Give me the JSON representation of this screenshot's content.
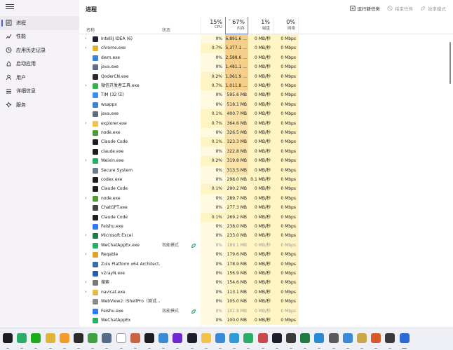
{
  "sidebar": {
    "items": [
      {
        "label": "进程",
        "icon": "processes-icon",
        "active": true
      },
      {
        "label": "性能",
        "icon": "performance-icon"
      },
      {
        "label": "应用历史记录",
        "icon": "app-history-icon"
      },
      {
        "label": "启动应用",
        "icon": "startup-apps-icon"
      },
      {
        "label": "用户",
        "icon": "users-icon"
      },
      {
        "label": "详细信息",
        "icon": "details-icon"
      },
      {
        "label": "服务",
        "icon": "services-icon"
      }
    ]
  },
  "main": {
    "title": "进程",
    "toolbar": {
      "run_new_task": "运行新任务",
      "end_task": "结束任务",
      "efficiency_mode": "效率模式"
    }
  },
  "columns": {
    "name": "名称",
    "status": "状态",
    "cpu": {
      "pct": "15%",
      "label": "CPU"
    },
    "memory": {
      "pct": "67%",
      "label": "内存"
    },
    "disk": {
      "pct": "1%",
      "label": "磁盘"
    },
    "network": {
      "pct": "0%",
      "label": "网络"
    }
  },
  "processes": [
    {
      "name": "IntelliJ IDEA (6)",
      "expand": true,
      "status": "",
      "cpu": "0%",
      "mem": "6,891.6 ...",
      "disk": "0 MB/秒",
      "net": "0 Mbps",
      "icon_color": "#1d1d2b"
    },
    {
      "name": "chrome.exe",
      "expand": true,
      "status": "",
      "cpu": "0.7%",
      "mem": "5,377.1 ...",
      "disk": "0 MB/秒",
      "net": "0 Mbps",
      "icon_color": "#e2b33a"
    },
    {
      "name": "dwm.exe",
      "expand": false,
      "status": "",
      "cpu": "0%",
      "mem": "2,588.6 ...",
      "disk": "0 MB/秒",
      "net": "0 Mbps",
      "icon_color": "#3c83d6"
    },
    {
      "name": "java.exe",
      "expand": false,
      "status": "",
      "cpu": "0%",
      "mem": "1,481.1 ...",
      "disk": "0 MB/秒",
      "net": "0 Mbps",
      "icon_color": "#5c6b7e"
    },
    {
      "name": "QoderCN.exe",
      "expand": false,
      "status": "",
      "cpu": "0.2%",
      "mem": "1,061.9 ...",
      "disk": "0 MB/秒",
      "net": "0 Mbps",
      "icon_color": "#2a2a2a"
    },
    {
      "name": "微信开发者工具.exe",
      "expand": true,
      "status": "",
      "cpu": "0.7%",
      "mem": "1,011.8 ...",
      "disk": "0 MB/秒",
      "net": "0 Mbps",
      "icon_color": "#36b04a"
    },
    {
      "name": "TIM (32 位)",
      "expand": false,
      "status": "",
      "cpu": "0%",
      "mem": "595.6 MB",
      "disk": "0 MB/秒",
      "net": "0 Mbps",
      "icon_color": "#3b8ef2"
    },
    {
      "name": "wsappx",
      "expand": false,
      "status": "",
      "cpu": "0%",
      "mem": "518.1 MB",
      "disk": "0 MB/秒",
      "net": "0 Mbps",
      "icon_color": "#3c83d6"
    },
    {
      "name": "java.exe",
      "expand": false,
      "status": "",
      "cpu": "0.1%",
      "mem": "400.7 MB",
      "disk": "0 MB/秒",
      "net": "0 Mbps",
      "icon_color": "#5c6b7e"
    },
    {
      "name": "explorer.exe",
      "expand": true,
      "status": "",
      "cpu": "0.7%",
      "mem": "364.6 MB",
      "disk": "0 MB/秒",
      "net": "0 Mbps",
      "icon_color": "#f2c24a"
    },
    {
      "name": "node.exe",
      "expand": false,
      "status": "",
      "cpu": "0%",
      "mem": "326.5 MB",
      "disk": "0 MB/秒",
      "net": "0 Mbps",
      "icon_color": "#4f9a3a"
    },
    {
      "name": "Claude Code",
      "expand": false,
      "status": "",
      "cpu": "0.1%",
      "mem": "323.3 MB",
      "disk": "0 MB/秒",
      "net": "0 Mbps",
      "icon_color": "#1e1e1e"
    },
    {
      "name": "claude.exe",
      "expand": false,
      "status": "",
      "cpu": "0%",
      "mem": "322.8 MB",
      "disk": "0 MB/秒",
      "net": "0 Mbps",
      "icon_color": "#1e1e1e"
    },
    {
      "name": "Weixin.exe",
      "expand": true,
      "status": "",
      "cpu": "0.2%",
      "mem": "319.8 MB",
      "disk": "0 MB/秒",
      "net": "0 Mbps",
      "icon_color": "#2aae67"
    },
    {
      "name": "Secure System",
      "expand": false,
      "status": "",
      "cpu": "0%",
      "mem": "313.5 MB",
      "disk": "0 MB/秒",
      "net": "0 Mbps",
      "icon_color": "#6c7a8a"
    },
    {
      "name": "codex.exe",
      "expand": false,
      "status": "",
      "cpu": "0%",
      "mem": "298.0 MB",
      "disk": "0.1 MB/秒",
      "net": "0 Mbps",
      "icon_color": "#1e1e1e"
    },
    {
      "name": "Claude Code",
      "expand": false,
      "status": "",
      "cpu": "0.1%",
      "mem": "290.2 MB",
      "disk": "0 MB/秒",
      "net": "0 Mbps",
      "icon_color": "#1e1e1e"
    },
    {
      "name": "node.exe",
      "expand": true,
      "status": "",
      "cpu": "0%",
      "mem": "289.7 MB",
      "disk": "0 MB/秒",
      "net": "0 Mbps",
      "icon_color": "#4f9a3a"
    },
    {
      "name": "ChatGPT.exe",
      "expand": false,
      "status": "",
      "cpu": "0%",
      "mem": "277.3 MB",
      "disk": "0 MB/秒",
      "net": "0 Mbps",
      "icon_color": "#444444"
    },
    {
      "name": "Claude Code",
      "expand": false,
      "status": "",
      "cpu": "0.1%",
      "mem": "269.2 MB",
      "disk": "0 MB/秒",
      "net": "0 Mbps",
      "icon_color": "#1e1e1e"
    },
    {
      "name": "Feishu.exe",
      "expand": false,
      "status": "",
      "cpu": "0%",
      "mem": "238.0 MB",
      "disk": "0 MB/秒",
      "net": "0 Mbps",
      "icon_color": "#2f7af2"
    },
    {
      "name": "Microsoft Excel",
      "expand": true,
      "status": "",
      "cpu": "0%",
      "mem": "233.0 MB",
      "disk": "0 MB/秒",
      "net": "0 Mbps",
      "icon_color": "#1f7a43"
    },
    {
      "name": "WeChatAppEx.exe",
      "expand": false,
      "status": "效能模式",
      "leaf": true,
      "cpu": "0%",
      "mem": "189.1 MB",
      "disk": "0 MB/秒",
      "net": "0 Mbps",
      "icon_color": "#2aae67"
    },
    {
      "name": "Reqable",
      "expand": true,
      "status": "",
      "cpu": "0%",
      "mem": "179.6 MB",
      "disk": "0 MB/秒",
      "net": "0 Mbps",
      "icon_color": "#e0a32a"
    },
    {
      "name": "Zulu Platform x64 Architect...",
      "expand": false,
      "status": "",
      "cpu": "0%",
      "mem": "178.9 MB",
      "disk": "0 MB/秒",
      "net": "0 Mbps",
      "icon_color": "#3b6ea8"
    },
    {
      "name": "v2rayN.exe",
      "expand": false,
      "status": "",
      "cpu": "0%",
      "mem": "156.9 MB",
      "disk": "0 MB/秒",
      "net": "0 Mbps",
      "icon_color": "#2a5fa8"
    },
    {
      "name": "搜索",
      "expand": true,
      "status": "",
      "cpu": "0%",
      "mem": "154.6 MB",
      "disk": "0 MB/秒",
      "net": "0 Mbps",
      "icon_color": "#777777"
    },
    {
      "name": "navicat.exe",
      "expand": true,
      "status": "",
      "cpu": "0%",
      "mem": "113.1 MB",
      "disk": "0 MB/秒",
      "net": "0 Mbps",
      "icon_color": "#e9b84a"
    },
    {
      "name": "WebView2: iShellPro（测试...",
      "expand": false,
      "status": "",
      "cpu": "0%",
      "mem": "105.0 MB",
      "disk": "0 MB/秒",
      "net": "0 Mbps",
      "icon_color": "#8a8a8a"
    },
    {
      "name": "Feishu.exe",
      "expand": false,
      "status": "效能模式",
      "leaf": true,
      "cpu": "0%",
      "mem": "102.8 MB",
      "disk": "0 MB/秒",
      "net": "0 Mbps",
      "icon_color": "#2f7af2"
    },
    {
      "name": "WeChatAppEx",
      "expand": false,
      "status": "",
      "cpu": "0%",
      "mem": "100.0 MB",
      "disk": "0 MB/秒",
      "net": "0 Mbps",
      "icon_color": "#2aae67"
    }
  ],
  "taskbar": {
    "icons": [
      {
        "name": "terminal-icon",
        "color": "#1e1e1e"
      },
      {
        "name": "wechat-icon",
        "color": "#2aae67"
      },
      {
        "name": "wechat-dev-icon",
        "color": "#1aad19"
      },
      {
        "name": "chrome-icon",
        "color": "#e2b33a"
      },
      {
        "name": "cloud-icon",
        "color": "#f39c2b"
      },
      {
        "name": "console-icon",
        "color": "#2b2b2b"
      },
      {
        "name": "hbuilder-icon",
        "color": "#3fa142"
      },
      {
        "name": "app-icon",
        "color": "#556b8a"
      },
      {
        "name": "chatgpt-icon",
        "color": "#ffffff"
      },
      {
        "name": "claude-icon",
        "color": "#c96442"
      },
      {
        "name": "dev-icon",
        "color": "#1e1e1e"
      },
      {
        "name": "navicat-icon",
        "color": "#3a8bd6"
      },
      {
        "name": "app-icon-2",
        "color": "#6c2ad0"
      },
      {
        "name": "intellij-icon",
        "color": "#1d1d2b"
      },
      {
        "name": "folder-icon",
        "color": "#f2c24a"
      },
      {
        "name": "feishu-icon",
        "color": "#3a8bd6"
      },
      {
        "name": "app-icon-3",
        "color": "#2e9bd6"
      },
      {
        "name": "wechat-app-icon",
        "color": "#2aae67"
      },
      {
        "name": "app-icon-4",
        "color": "#c94a4a"
      },
      {
        "name": "intellij-icon-2",
        "color": "#1d1d2b"
      },
      {
        "name": "app-icon-5",
        "color": "#3a3a3a"
      },
      {
        "name": "excel-icon",
        "color": "#1f7a43"
      },
      {
        "name": "app-icon-6",
        "color": "#2a8ad6"
      },
      {
        "name": "app-icon-7",
        "color": "#5a5a5a"
      },
      {
        "name": "app-icon-8",
        "color": "#3a8bd6"
      },
      {
        "name": "app-icon-9",
        "color": "#c9a84a"
      },
      {
        "name": "app-icon-10",
        "color": "#d65a2a"
      },
      {
        "name": "app-icon-11",
        "color": "#3a3a3a"
      },
      {
        "name": "task-manager-icon",
        "color": "#2a6ad6"
      }
    ]
  }
}
